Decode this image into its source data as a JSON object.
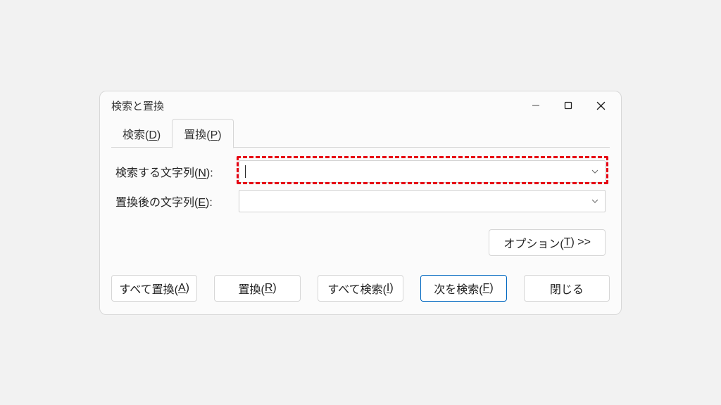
{
  "title": "検索と置換",
  "tabs": {
    "search": {
      "pre": "検索(",
      "accel": "D",
      "post": ")"
    },
    "replace": {
      "pre": "置換(",
      "accel": "P",
      "post": ")"
    }
  },
  "fields": {
    "search_label": {
      "pre": "検索する文字列(",
      "accel": "N",
      "post": "):"
    },
    "replace_label": {
      "pre": "置換後の文字列(",
      "accel": "E",
      "post": "):"
    },
    "search_value": "",
    "replace_value": ""
  },
  "options_btn": {
    "pre": "オプション(",
    "accel": "T",
    "post": ") >>"
  },
  "buttons": {
    "replace_all": {
      "pre": "すべて置換(",
      "accel": "A",
      "post": ")"
    },
    "replace": {
      "pre": "置換(",
      "accel": "R",
      "post": ")"
    },
    "find_all": {
      "pre": "すべて検索(",
      "accel": "I",
      "post": ")"
    },
    "find_next": {
      "pre": "次を検索(",
      "accel": "F",
      "post": ")"
    },
    "close": {
      "text": "閉じる"
    }
  }
}
